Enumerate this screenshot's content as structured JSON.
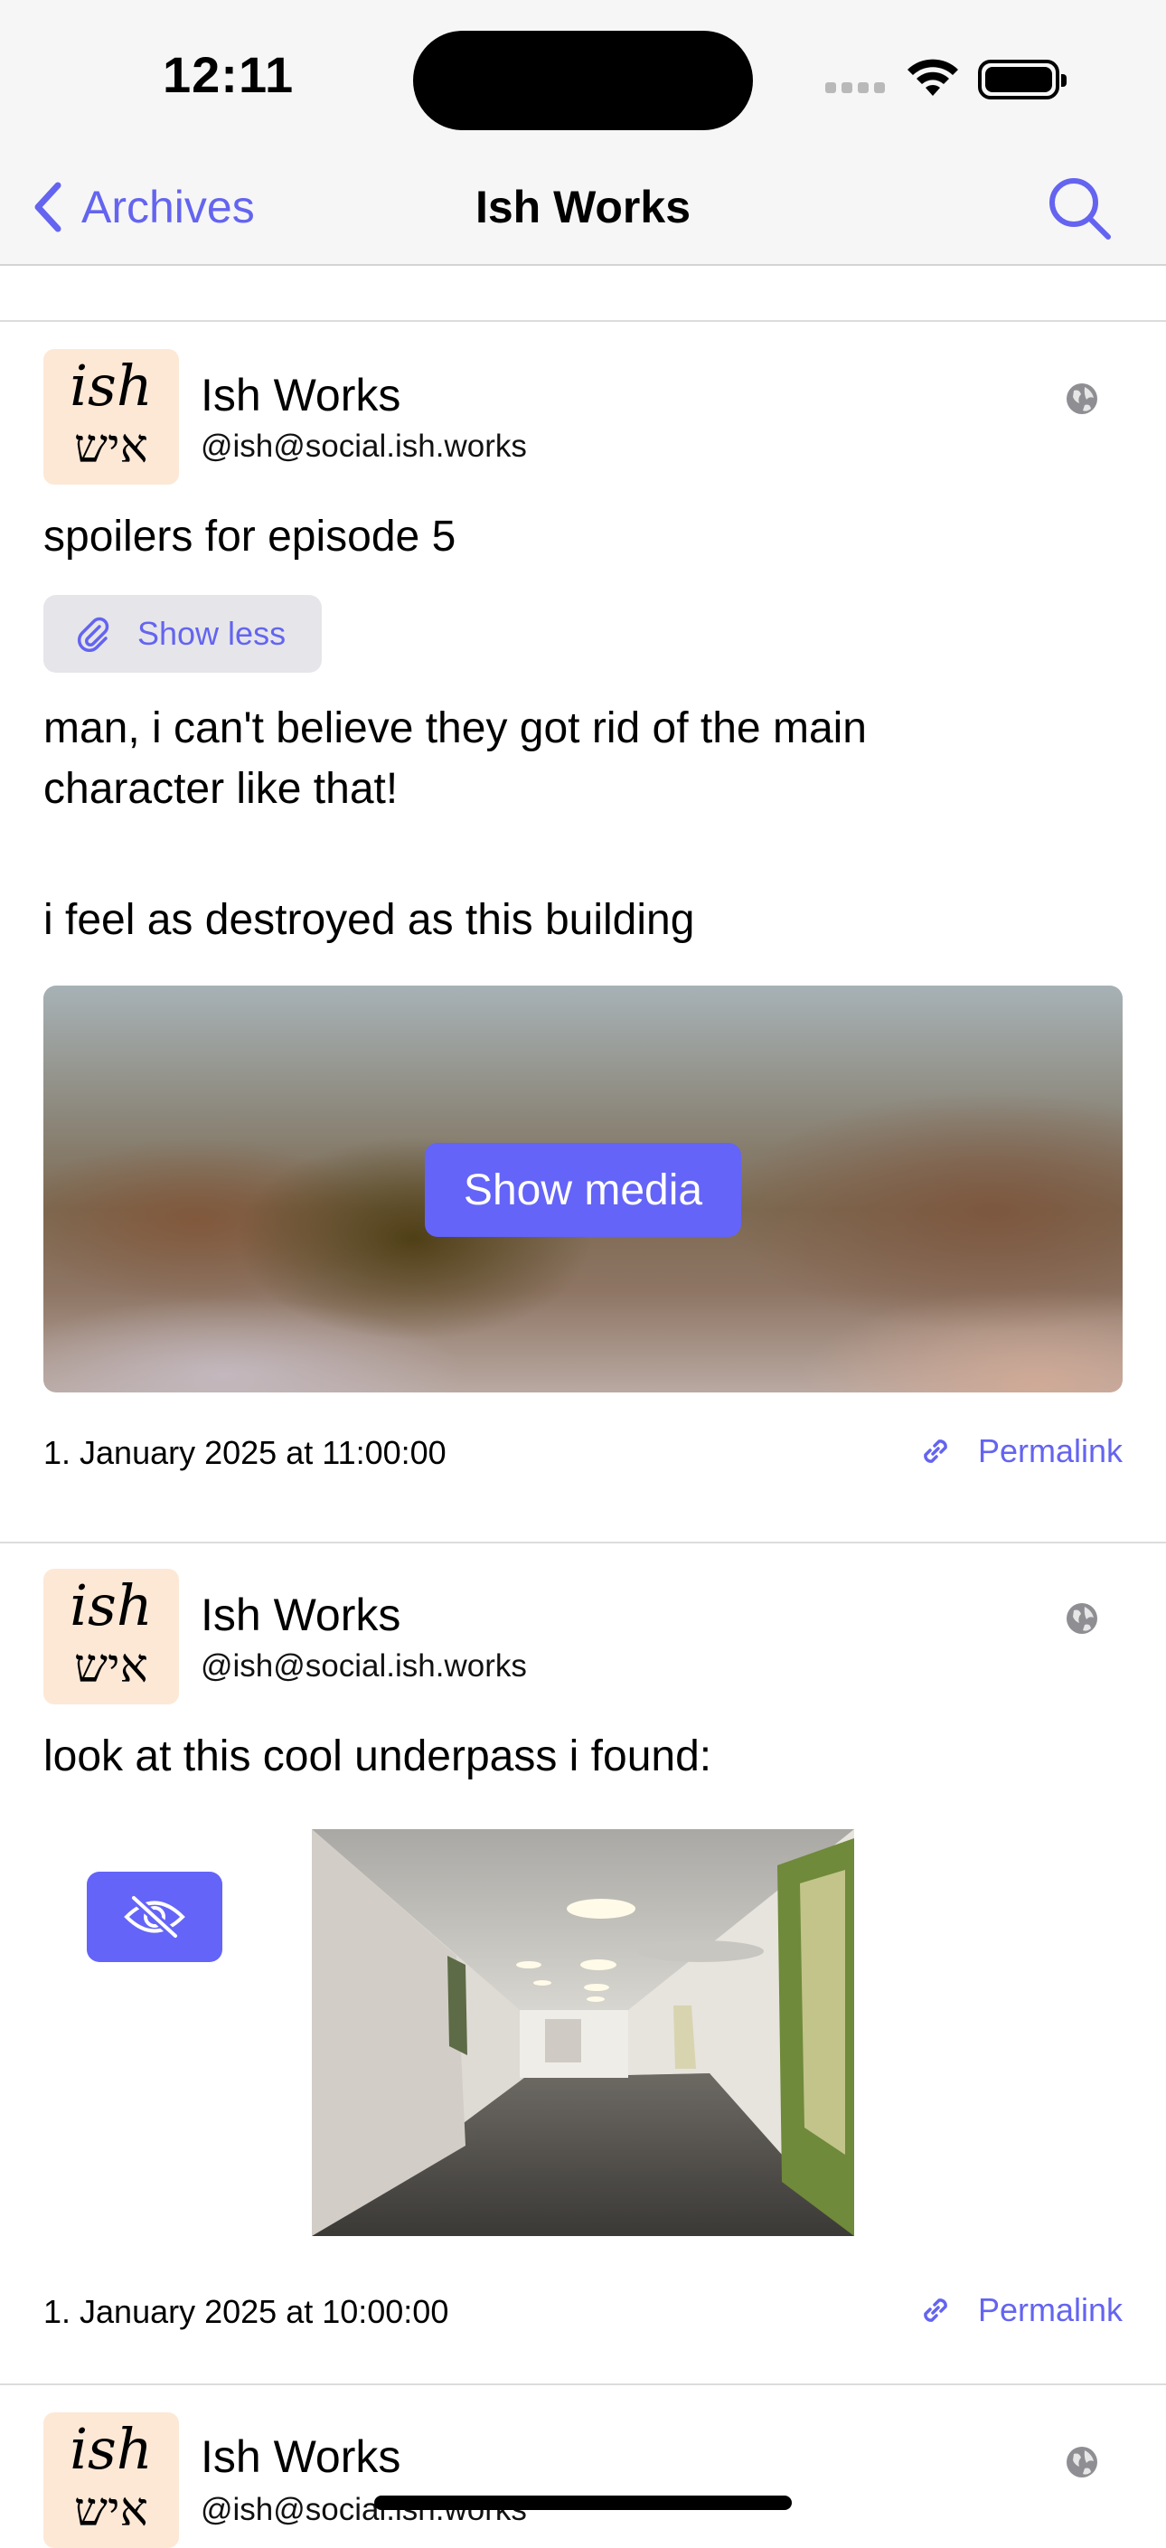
{
  "status_bar": {
    "time": "12:11"
  },
  "nav": {
    "back_label": "Archives",
    "title": "Ish Works"
  },
  "avatar": {
    "line1": "ish",
    "line2": "איש"
  },
  "posts": [
    {
      "author": "Ish Works",
      "handle": "@ish@social.ish.works",
      "content_warning": "spoilers for episode 5",
      "show_less_label": "Show less",
      "text_line1": "man, i can't believe they got rid of the main",
      "text_line2": "character like that!",
      "text_line3": "i feel as destroyed as this building",
      "show_media_label": "Show media",
      "date": "1. January 2025 at 11:00:00",
      "permalink_label": "Permalink"
    },
    {
      "author": "Ish Works",
      "handle": "@ish@social.ish.works",
      "text": "look at this cool underpass i found:",
      "date": "1. January 2025 at 10:00:00",
      "permalink_label": "Permalink"
    },
    {
      "author": "Ish Works",
      "handle": "@ish@social.ish.works"
    }
  ],
  "colors": {
    "accent": "#6464f0",
    "button": "#6464f8",
    "avatar_bg": "#fde8d6",
    "bar_bg": "#f6f6f6"
  },
  "icons": [
    "chevron-left-icon",
    "search-icon",
    "globe-icon",
    "paperclip-icon",
    "link-icon",
    "eye-slash-icon"
  ]
}
